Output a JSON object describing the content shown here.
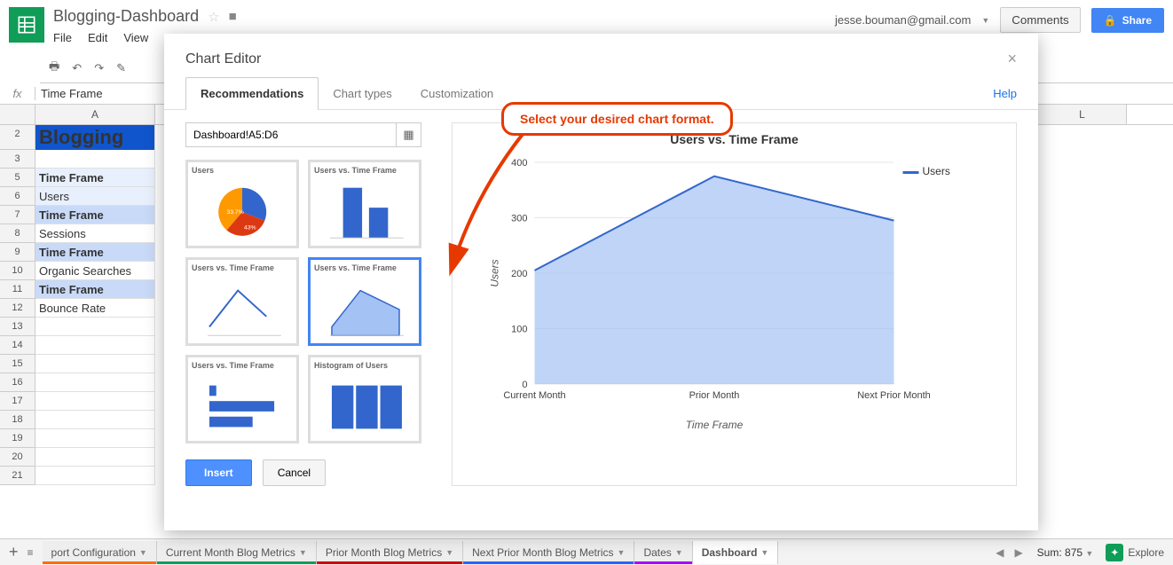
{
  "header": {
    "doc_title": "Blogging-Dashboard",
    "user_email": "jesse.bouman@gmail.com",
    "comments_btn": "Comments",
    "share_btn": "Share",
    "menus": [
      "File",
      "Edit",
      "View"
    ]
  },
  "fx": {
    "label": "fx",
    "value": "Time Frame"
  },
  "columns": [
    "A",
    "L"
  ],
  "rows": {
    "2": "Blogging",
    "5": "Time Frame",
    "6": "Users",
    "7": "Time Frame",
    "8": "Sessions",
    "9": "Time Frame",
    "10": "Organic Searches",
    "11": "Time Frame",
    "12": "Bounce Rate"
  },
  "row_numbers": [
    "2",
    "3",
    "5",
    "6",
    "7",
    "8",
    "9",
    "10",
    "11",
    "12",
    "13",
    "14",
    "15",
    "16",
    "17",
    "18",
    "19",
    "20",
    "21"
  ],
  "modal": {
    "title": "Chart Editor",
    "tabs": [
      "Recommendations",
      "Chart types",
      "Customization"
    ],
    "help": "Help",
    "range": "Dashboard!A5:D6",
    "recs": [
      {
        "title": "Users"
      },
      {
        "title": "Users vs. Time Frame"
      },
      {
        "title": "Users vs. Time Frame"
      },
      {
        "title": "Users vs. Time Frame"
      },
      {
        "title": "Users vs. Time Frame"
      },
      {
        "title": "Histogram of Users"
      }
    ],
    "insert": "Insert",
    "cancel": "Cancel"
  },
  "annotation": "Select your desired chart format.",
  "preview": {
    "title": "Users vs. Time Frame",
    "legend": "Users",
    "ylabel": "Users",
    "xlabel": "Time Frame"
  },
  "chart_data": {
    "type": "area",
    "title": "Users vs. Time Frame",
    "xlabel": "Time Frame",
    "ylabel": "Users",
    "categories": [
      "Current Month",
      "Prior Month",
      "Next Prior Month"
    ],
    "series": [
      {
        "name": "Users",
        "values": [
          205,
          375,
          295
        ]
      }
    ],
    "ylim": [
      0,
      400
    ],
    "yticks": [
      0,
      100,
      200,
      300,
      400
    ]
  },
  "pie_data": {
    "slices": [
      {
        "label": "43%",
        "value": 43,
        "color": "#dc3912"
      },
      {
        "label": "33.7%",
        "value": 33.7,
        "color": "#ff9900"
      },
      {
        "label": "",
        "value": 23.3,
        "color": "#3366cc"
      }
    ]
  },
  "sheets": [
    {
      "name": "port Configuration",
      "color": "#ff6d00",
      "active": false,
      "truncated": true
    },
    {
      "name": "Current Month Blog Metrics",
      "color": "#0f9d58",
      "active": false
    },
    {
      "name": "Prior Month Blog Metrics",
      "color": "#d50000",
      "active": false
    },
    {
      "name": "Next Prior Month Blog Metrics",
      "color": "#2962ff",
      "active": false
    },
    {
      "name": "Dates",
      "color": "#aa00ff",
      "active": false
    },
    {
      "name": "Dashboard",
      "color": "",
      "active": true
    }
  ],
  "footer": {
    "sum": "Sum: 875",
    "explore": "Explore"
  }
}
